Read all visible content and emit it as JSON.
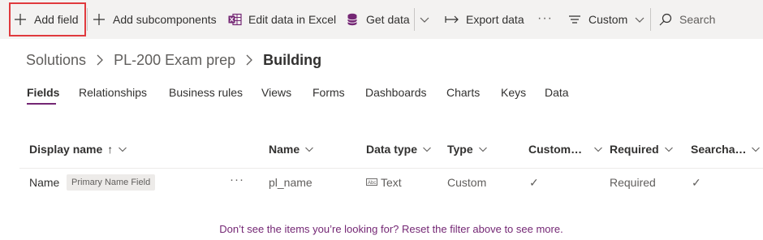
{
  "toolbar": {
    "add_field": "Add field",
    "add_subcomponents": "Add subcomponents",
    "edit_excel": "Edit data in Excel",
    "get_data": "Get data",
    "export_data": "Export data",
    "more": "···",
    "view": "Custom",
    "search_placeholder": "Search"
  },
  "breadcrumb": {
    "items": [
      "Solutions",
      "PL-200 Exam prep",
      "Building"
    ]
  },
  "tabs": [
    {
      "label": "Fields",
      "active": true
    },
    {
      "label": "Relationships"
    },
    {
      "label": "Business rules"
    },
    {
      "label": "Views"
    },
    {
      "label": "Forms"
    },
    {
      "label": "Dashboards"
    },
    {
      "label": "Charts"
    },
    {
      "label": "Keys"
    },
    {
      "label": "Data"
    }
  ],
  "table": {
    "columns": [
      "Display name",
      "Name",
      "Data type",
      "Type",
      "Custom…",
      "Required",
      "Searcha…"
    ],
    "sort_indicator": "↑",
    "rows": [
      {
        "display_name": "Name",
        "badge": "Primary Name Field",
        "more": "···",
        "name": "pl_name",
        "data_type": "Text",
        "type": "Custom",
        "customizable": "✓",
        "required": "Required",
        "searchable": "✓"
      }
    ]
  },
  "footer_note": "Don’t see the items you’re looking for? Reset the filter above to see more.",
  "colors": {
    "accent": "#742774",
    "highlight_border": "#e03a3e",
    "toolbar_bg": "#f3f2f1"
  },
  "icons": {
    "add": "plus-icon",
    "excel": "excel-icon",
    "database": "database-icon",
    "export": "export-arrow-icon",
    "view": "list-lines-icon",
    "search": "search-icon",
    "chevron": "chevron-down-icon",
    "text_type": "text-field-icon",
    "check": "check-icon"
  }
}
